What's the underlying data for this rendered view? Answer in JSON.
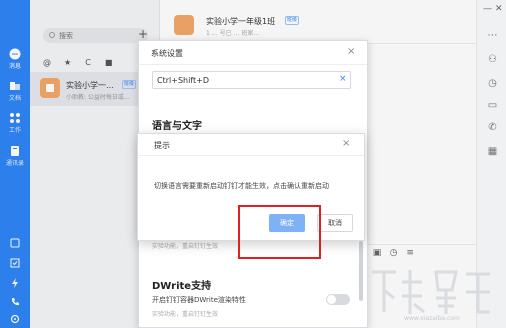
{
  "nav": {
    "items": [
      {
        "label": "消息",
        "icon": "chat-bubble-icon"
      },
      {
        "label": "文档",
        "icon": "document-icon"
      },
      {
        "label": "工作",
        "icon": "grid-icon"
      },
      {
        "label": "通讯录",
        "icon": "contacts-icon"
      }
    ],
    "bottom_icons": [
      "box-icon",
      "check-icon",
      "lightning-icon",
      "phone-icon",
      "settings-gear-icon"
    ]
  },
  "list": {
    "search_placeholder": "搜索",
    "add_symbol": "+",
    "filter_icons": [
      "@",
      "★",
      "C",
      "■"
    ],
    "conversation": {
      "title": "实验小学一…",
      "badge": "班级",
      "preview": "小助教: 公益时每日或…"
    }
  },
  "chat": {
    "title": "实验小学一年级1班",
    "badge": "班级",
    "subtitle": "1 … 号已 … 班家…"
  },
  "settings": {
    "title": "系统设置",
    "close": "×",
    "hotkey_value": "Ctrl+Shift+D",
    "hotkey_clear": "×",
    "section_language": "语言与文字",
    "restart_note": "实验功能，重启钉钉生效",
    "section_dwrite": "DWrite支持",
    "dwrite_option": "开启钉钉容器DWrite渲染特性",
    "dwrite_note": "实验功能，重启钉钉生效",
    "dwrite_enabled": false
  },
  "prompt": {
    "title": "提示",
    "close": "×",
    "message": "切换语言需要重新启动钉钉才能生效，点击确认重新启动",
    "ok_label": "确定",
    "cancel_label": "取消"
  },
  "colors": {
    "brand_blue": "#2f86f6",
    "highlight_red": "#e02020",
    "ok_button": "#7fb1f7"
  },
  "watermark": "下载吧"
}
